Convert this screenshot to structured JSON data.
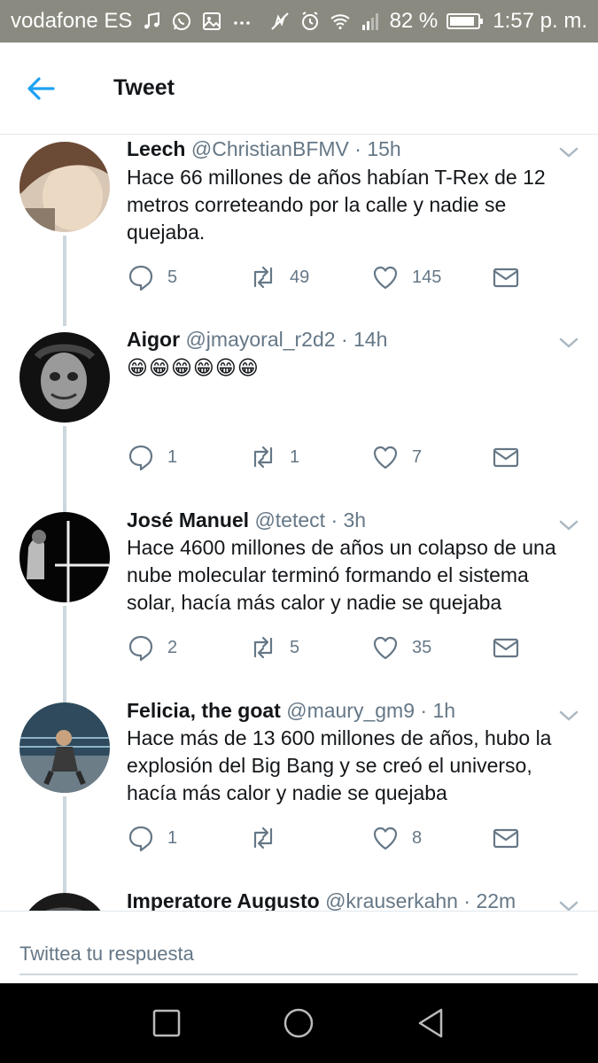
{
  "status_bar": {
    "carrier": "vodafone ES",
    "battery": "82 %",
    "time": "1:57 p. m."
  },
  "header": {
    "title": "Tweet"
  },
  "tweets": [
    {
      "name": "Leech",
      "handle": "@ChristianBFMV",
      "time": "15h",
      "text": "Hace 66 millones de años habían T-Rex de 12 metros correteando por la calle y nadie se quejaba.",
      "replies": "5",
      "retweets": "49",
      "likes": "145"
    },
    {
      "name": "Aigor",
      "handle": "@jmayoral_r2d2",
      "time": "14h",
      "text": "😁😁😁😁😁😁",
      "replies": "1",
      "retweets": "1",
      "likes": "7"
    },
    {
      "name": "José Manuel",
      "handle": "@tetect",
      "time": "3h",
      "text": "Hace 4600 millones de años un colapso de una nube molecular terminó formando el sistema solar, hacía más calor y nadie se quejaba",
      "replies": "2",
      "retweets": "5",
      "likes": "35"
    },
    {
      "name": "Felicia, the goat",
      "handle": "@maury_gm9",
      "time": "1h",
      "text": "Hace más de 13 600 millones de años, hubo la explosión del Big Bang y se creó el universo, hacía más calor y nadie se quejaba",
      "replies": "1",
      "retweets": "",
      "likes": "8"
    },
    {
      "name": "Imperatore Augusto",
      "handle": "@krauserkahn",
      "time": "22m"
    }
  ],
  "reply": {
    "placeholder": "Twittea tu respuesta"
  },
  "icons": {
    "back": "arrow-left-icon",
    "reply": "speech-bubble-icon",
    "retweet": "retweet-icon",
    "like": "heart-icon",
    "dm": "envelope-icon",
    "more": "chevron-down-icon"
  },
  "colors": {
    "accent": "#1da1f2",
    "status_bar": "#8a8a80",
    "muted": "#657786"
  }
}
